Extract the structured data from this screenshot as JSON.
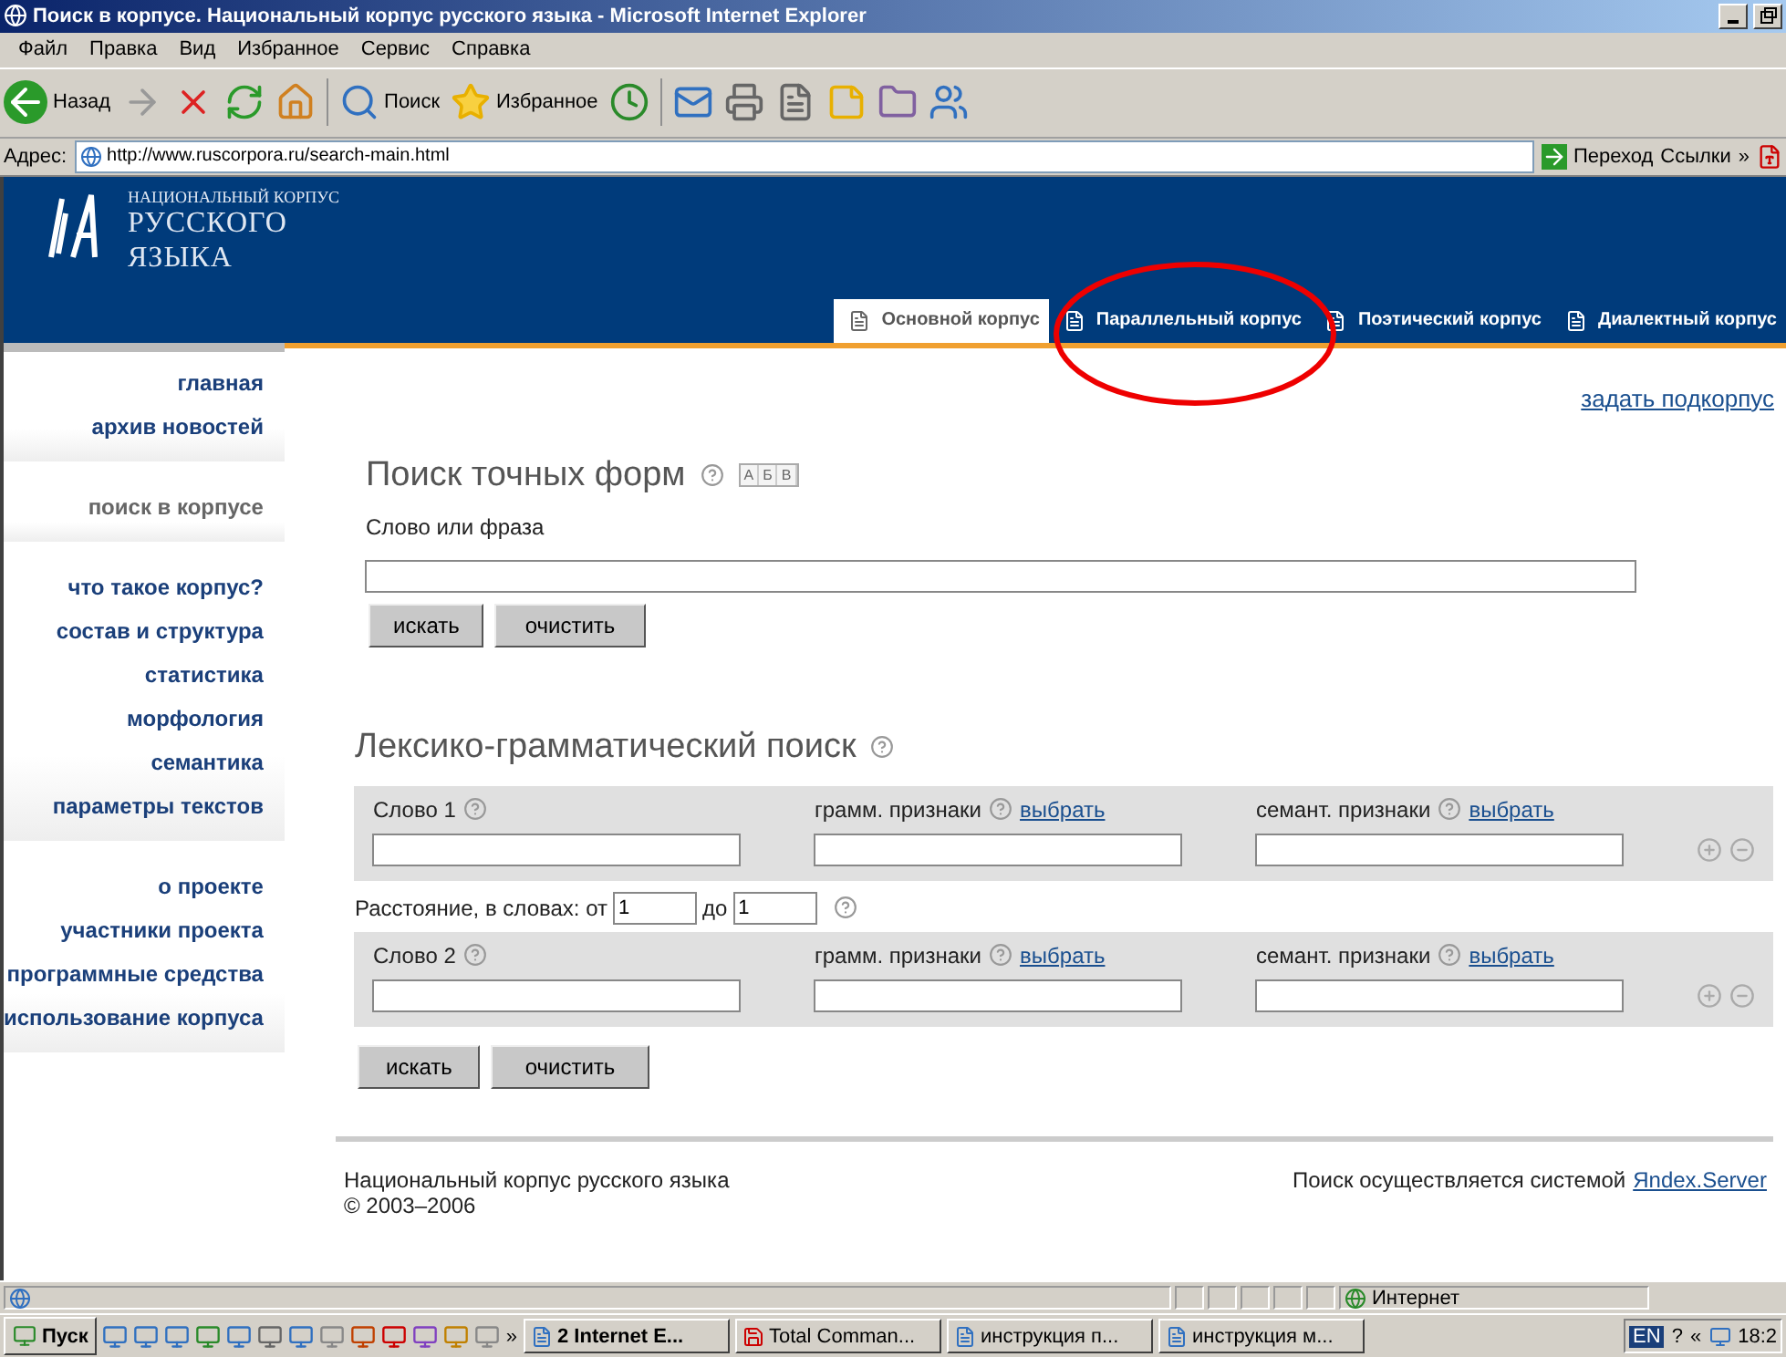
{
  "window": {
    "title": "Поиск в корпусе. Национальный корпус русского языка - Microsoft Internet Explorer"
  },
  "menu": [
    "Файл",
    "Правка",
    "Вид",
    "Избранное",
    "Сервис",
    "Справка"
  ],
  "toolbar": {
    "back": "Назад",
    "search": "Поиск",
    "favorites": "Избранное"
  },
  "address": {
    "label": "Адрес:",
    "url": "http://www.ruscorpora.ru/search-main.html",
    "go": "Переход",
    "links": "Ссылки",
    "more": "»"
  },
  "logo": {
    "line_1": "НАЦИОНАЛЬНЫЙ КОРПУС",
    "line_2": "РУССКОГО",
    "line_3": "ЯЗЫКА"
  },
  "tabs": [
    {
      "label": "Основной корпус",
      "selected": true
    },
    {
      "label": "Параллельный корпус",
      "selected": false
    },
    {
      "label": "Поэтический корпус",
      "selected": false
    },
    {
      "label": "Диалектный корпус",
      "selected": false
    }
  ],
  "sidebar": {
    "groups": [
      [
        {
          "label": "главная",
          "selected": false
        },
        {
          "label": "архив новостей",
          "selected": false
        }
      ],
      [
        {
          "label": "поиск в корпусе",
          "selected": true
        }
      ],
      [
        {
          "label": "что такое корпус?",
          "selected": false
        },
        {
          "label": "состав и структура",
          "selected": false
        },
        {
          "label": "статистика",
          "selected": false
        },
        {
          "label": "морфология",
          "selected": false
        },
        {
          "label": "семантика",
          "selected": false
        },
        {
          "label": "параметры текстов",
          "selected": false
        }
      ],
      [
        {
          "label": "о проекте",
          "selected": false
        },
        {
          "label": "участники проекта",
          "selected": false
        },
        {
          "label": "программные средства",
          "selected": false
        },
        {
          "label": "использование корпуса",
          "selected": false
        }
      ]
    ]
  },
  "subcorpus_link": "задать подкорпус",
  "exact_search": {
    "title": "Поиск точных форм",
    "keyboard_keys": [
      "А",
      "Б",
      "В"
    ],
    "field_label": "Слово или фраза",
    "buttons": [
      "искать",
      "очистить"
    ]
  },
  "lexgram_search": {
    "title": "Лексико-грамматический поиск",
    "words": [
      {
        "label": "Слово 1",
        "gram_label": "грамм. признаки",
        "gram_link": "выбрать",
        "sem_label": "семант. признаки",
        "sem_link": "выбрать"
      },
      {
        "label": "Слово 2",
        "gram_label": "грамм. признаки",
        "gram_link": "выбрать",
        "sem_label": "семант. признаки",
        "sem_link": "выбрать"
      }
    ],
    "distance": {
      "label": "Расстояние, в словах: от",
      "from": "1",
      "to_label": "до",
      "to": "1"
    },
    "buttons": [
      "искать",
      "очистить"
    ]
  },
  "footer": {
    "name": "Национальный корпус русского языка",
    "copyright": "© 2003–2006",
    "engine_text": "Поиск осуществляется системой",
    "engine_link": "Яndex.Server"
  },
  "status_bar": {
    "zone": "Интернет"
  },
  "taskbar": {
    "start": "Пуск",
    "more": "»",
    "tasks": [
      "2 Internet E...",
      "Total Comman...",
      "инструкция п...",
      "инструкция м..."
    ],
    "language": "EN",
    "help": "?",
    "tray_more": "«",
    "clock": "18:2"
  }
}
